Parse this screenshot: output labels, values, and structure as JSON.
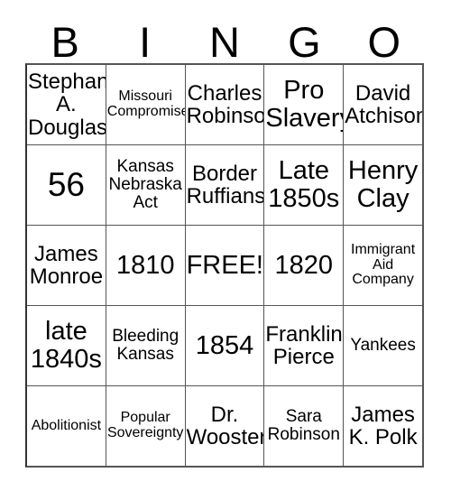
{
  "header": {
    "letters": [
      "B",
      "I",
      "N",
      "G",
      "O"
    ]
  },
  "colors": {
    "text": "#000000",
    "grid_line": "#555555",
    "background": "#ffffff"
  },
  "grid": {
    "rows": 5,
    "columns": 5,
    "free_space": "FREE!",
    "cells": [
      [
        {
          "text": "Stephan\nA.\nDouglas",
          "size": "md"
        },
        {
          "text": "Missouri\nCompromise",
          "size": "xs"
        },
        {
          "text": "Charles\nRobinson",
          "size": "md"
        },
        {
          "text": "Pro\nSlavery",
          "size": "lg"
        },
        {
          "text": "David\nAtchison",
          "size": "md"
        }
      ],
      [
        {
          "text": "56",
          "size": "xl"
        },
        {
          "text": "Kansas\nNebraska\nAct",
          "size": "sm"
        },
        {
          "text": "Border\nRuffians",
          "size": "md"
        },
        {
          "text": "Late\n1850s",
          "size": "lg"
        },
        {
          "text": "Henry\nClay",
          "size": "lg"
        }
      ],
      [
        {
          "text": "James\nMonroe",
          "size": "md"
        },
        {
          "text": "1810",
          "size": "lg"
        },
        {
          "text": "FREE!",
          "size": "lg"
        },
        {
          "text": "1820",
          "size": "lg"
        },
        {
          "text": "Immigrant\nAid\nCompany",
          "size": "xs"
        }
      ],
      [
        {
          "text": "late\n1840s",
          "size": "lg"
        },
        {
          "text": "Bleeding\nKansas",
          "size": "sm"
        },
        {
          "text": "1854",
          "size": "lg"
        },
        {
          "text": "Franklin\nPierce",
          "size": "md"
        },
        {
          "text": "Yankees",
          "size": "sm"
        }
      ],
      [
        {
          "text": "Abolitionist",
          "size": "xs"
        },
        {
          "text": "Popular\nSovereignty",
          "size": "xs"
        },
        {
          "text": "Dr.\nWooster",
          "size": "md"
        },
        {
          "text": "Sara\nRobinson",
          "size": "sm"
        },
        {
          "text": "James\nK. Polk",
          "size": "md"
        }
      ]
    ]
  }
}
